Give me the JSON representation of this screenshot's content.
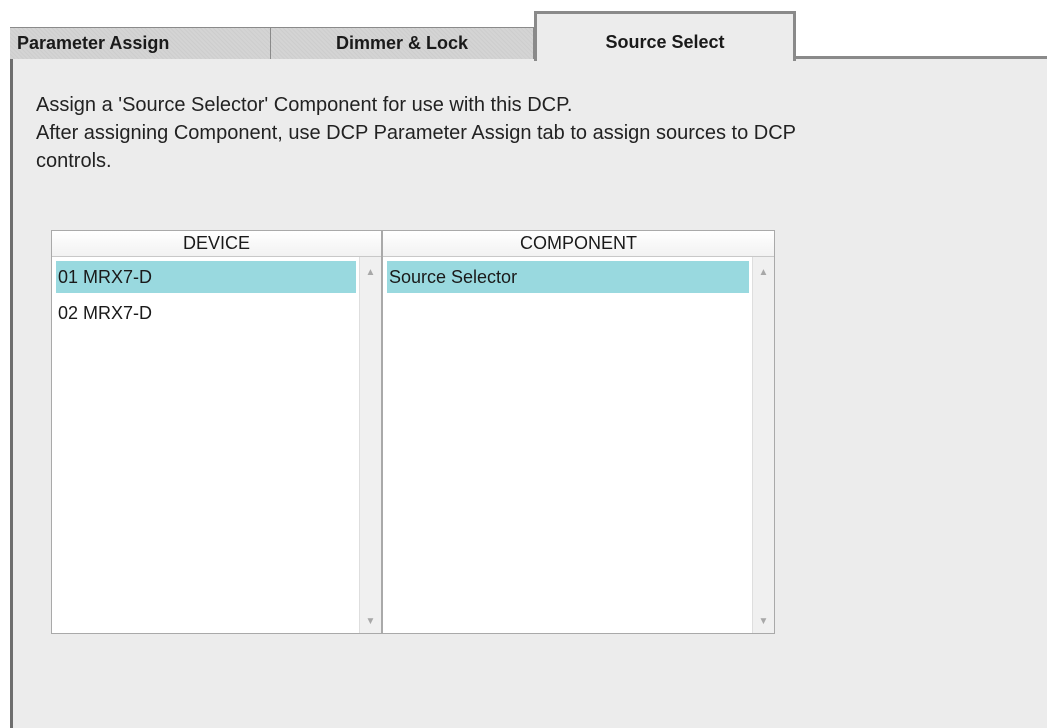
{
  "tabs": [
    {
      "label": "Parameter Assign",
      "active": false
    },
    {
      "label": "Dimmer & Lock",
      "active": false
    },
    {
      "label": "Source Select",
      "active": true
    }
  ],
  "description": {
    "line1": "Assign a 'Source Selector' Component for use with this DCP.",
    "line2": "After assigning Component, use DCP Parameter Assign tab to assign sources to DCP",
    "line3": "controls."
  },
  "device_list": {
    "header": "DEVICE",
    "items": [
      {
        "label": "01 MRX7-D",
        "selected": true
      },
      {
        "label": "02 MRX7-D",
        "selected": false
      }
    ]
  },
  "component_list": {
    "header": "COMPONENT",
    "items": [
      {
        "label": "Source Selector",
        "selected": true
      }
    ]
  },
  "colors": {
    "selection": "#99d9df",
    "panel": "#ececec",
    "tab_inactive": "#d4d4d4"
  },
  "icons": {
    "scroll_up": "caret-up-icon",
    "scroll_down": "caret-down-icon"
  }
}
